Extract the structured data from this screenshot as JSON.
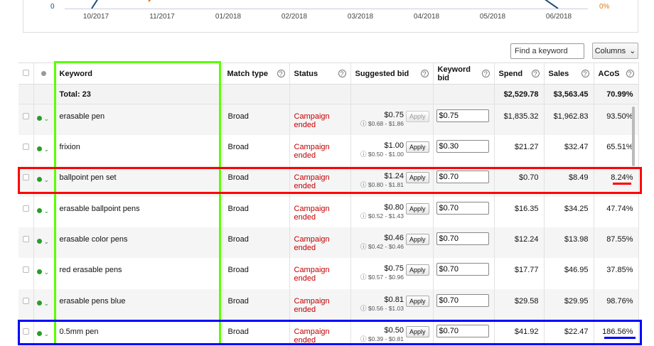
{
  "chart": {
    "y_left_label": "0",
    "y_right_label": "0%",
    "x_ticks": [
      "10/2017",
      "11/2017",
      "01/2018",
      "02/2018",
      "03/2018",
      "04/2018",
      "05/2018",
      "06/2018"
    ]
  },
  "toolbar": {
    "search_placeholder": "Find a keyword",
    "columns_label": "Columns"
  },
  "table": {
    "headers": {
      "keyword": "Keyword",
      "match_type": "Match type",
      "status": "Status",
      "suggested_bid": "Suggested bid",
      "keyword_bid": "Keyword bid",
      "spend": "Spend",
      "sales": "Sales",
      "acos": "ACoS"
    },
    "total": {
      "label": "Total: 23",
      "spend": "$2,529.78",
      "sales": "$3,563.45",
      "acos": "70.99%"
    },
    "apply_label": "Apply",
    "rows": [
      {
        "keyword": "erasable pen",
        "match_type": "Broad",
        "status": "Campaign ended",
        "suggested_bid": "$0.75",
        "bid_range": "ⓘ $0.68 - $1.86",
        "keyword_bid": "$0.75",
        "spend": "$1,835.32",
        "sales": "$1,962.83",
        "acos": "93.50%"
      },
      {
        "keyword": "frixion",
        "match_type": "Broad",
        "status": "Campaign ended",
        "suggested_bid": "$1.00",
        "bid_range": "ⓘ $0.50 - $1.00",
        "keyword_bid": "$0.30",
        "spend": "$21.27",
        "sales": "$32.47",
        "acos": "65.51%"
      },
      {
        "keyword": "ballpoint pen set",
        "match_type": "Broad",
        "status": "Campaign ended",
        "suggested_bid": "$1.24",
        "bid_range": "ⓘ $0.80 - $1.81",
        "keyword_bid": "$0.70",
        "spend": "$0.70",
        "sales": "$8.49",
        "acos": "8.24%"
      },
      {
        "keyword": "erasable ballpoint pens",
        "match_type": "Broad",
        "status": "Campaign ended",
        "suggested_bid": "$0.80",
        "bid_range": "ⓘ $0.52 - $1.43",
        "keyword_bid": "$0.70",
        "spend": "$16.35",
        "sales": "$34.25",
        "acos": "47.74%"
      },
      {
        "keyword": "erasable color pens",
        "match_type": "Broad",
        "status": "Campaign ended",
        "suggested_bid": "$0.46",
        "bid_range": "ⓘ $0.42 - $0.46",
        "keyword_bid": "$0.70",
        "spend": "$12.24",
        "sales": "$13.98",
        "acos": "87.55%"
      },
      {
        "keyword": "red erasable pens",
        "match_type": "Broad",
        "status": "Campaign ended",
        "suggested_bid": "$0.75",
        "bid_range": "ⓘ $0.57 - $0.96",
        "keyword_bid": "$0.70",
        "spend": "$17.77",
        "sales": "$46.95",
        "acos": "37.85%"
      },
      {
        "keyword": "erasable pens blue",
        "match_type": "Broad",
        "status": "Campaign ended",
        "suggested_bid": "$0.81",
        "bid_range": "ⓘ $0.56 - $1.03",
        "keyword_bid": "$0.70",
        "spend": "$29.58",
        "sales": "$29.95",
        "acos": "98.76%"
      },
      {
        "keyword": "0.5mm pen",
        "match_type": "Broad",
        "status": "Campaign ended",
        "suggested_bid": "$0.50",
        "bid_range": "ⓘ $0.39 - $0.81",
        "keyword_bid": "$0.70",
        "spend": "$41.92",
        "sales": "$22.47",
        "acos": "186.56%"
      }
    ]
  },
  "colors": {
    "highlight_keyword_column": "#5bff00",
    "highlight_low_acos_row": "#ff0000",
    "highlight_high_acos_row": "#0000ff",
    "status_ended": "#c40000",
    "status_dot": "#2a9d2a"
  }
}
